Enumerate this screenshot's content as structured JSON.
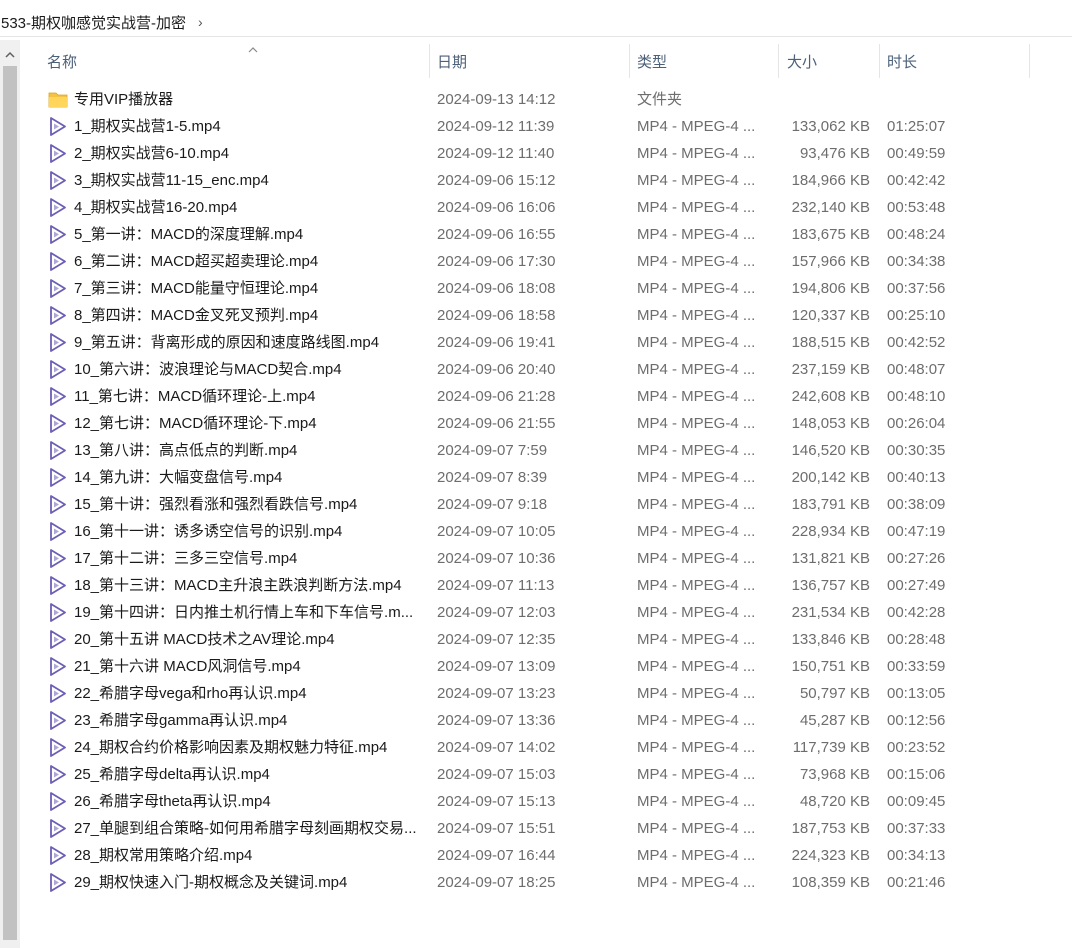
{
  "breadcrumb": {
    "path": "533-期权咖感觉实战营-加密"
  },
  "columns": {
    "name": "名称",
    "date": "日期",
    "type": "类型",
    "size": "大小",
    "duration": "时长"
  },
  "files": [
    {
      "name": "专用VIP播放器",
      "date": "2024-09-13 14:12",
      "type": "文件夹",
      "size": "",
      "duration": "",
      "icon": "folder-icon"
    },
    {
      "name": "1_期权实战营1-5.mp4",
      "date": "2024-09-12 11:39",
      "type": "MP4 - MPEG-4 ...",
      "size": "133,062 KB",
      "duration": "01:25:07",
      "icon": "video-file-icon"
    },
    {
      "name": "2_期权实战营6-10.mp4",
      "date": "2024-09-12 11:40",
      "type": "MP4 - MPEG-4 ...",
      "size": "93,476 KB",
      "duration": "00:49:59",
      "icon": "video-file-icon"
    },
    {
      "name": "3_期权实战营11-15_enc.mp4",
      "date": "2024-09-06 15:12",
      "type": "MP4 - MPEG-4 ...",
      "size": "184,966 KB",
      "duration": "00:42:42",
      "icon": "video-file-icon"
    },
    {
      "name": "4_期权实战营16-20.mp4",
      "date": "2024-09-06 16:06",
      "type": "MP4 - MPEG-4 ...",
      "size": "232,140 KB",
      "duration": "00:53:48",
      "icon": "video-file-icon"
    },
    {
      "name": "5_第一讲：MACD的深度理解.mp4",
      "date": "2024-09-06 16:55",
      "type": "MP4 - MPEG-4 ...",
      "size": "183,675 KB",
      "duration": "00:48:24",
      "icon": "video-file-icon"
    },
    {
      "name": "6_第二讲：MACD超买超卖理论.mp4",
      "date": "2024-09-06 17:30",
      "type": "MP4 - MPEG-4 ...",
      "size": "157,966 KB",
      "duration": "00:34:38",
      "icon": "video-file-icon"
    },
    {
      "name": "7_第三讲：MACD能量守恒理论.mp4",
      "date": "2024-09-06 18:08",
      "type": "MP4 - MPEG-4 ...",
      "size": "194,806 KB",
      "duration": "00:37:56",
      "icon": "video-file-icon"
    },
    {
      "name": "8_第四讲：MACD金叉死叉预判.mp4",
      "date": "2024-09-06 18:58",
      "type": "MP4 - MPEG-4 ...",
      "size": "120,337 KB",
      "duration": "00:25:10",
      "icon": "video-file-icon"
    },
    {
      "name": "9_第五讲：背离形成的原因和速度路线图.mp4",
      "date": "2024-09-06 19:41",
      "type": "MP4 - MPEG-4 ...",
      "size": "188,515 KB",
      "duration": "00:42:52",
      "icon": "video-file-icon"
    },
    {
      "name": "10_第六讲：波浪理论与MACD契合.mp4",
      "date": "2024-09-06 20:40",
      "type": "MP4 - MPEG-4 ...",
      "size": "237,159 KB",
      "duration": "00:48:07",
      "icon": "video-file-icon"
    },
    {
      "name": "11_第七讲：MACD循环理论-上.mp4",
      "date": "2024-09-06 21:28",
      "type": "MP4 - MPEG-4 ...",
      "size": "242,608 KB",
      "duration": "00:48:10",
      "icon": "video-file-icon"
    },
    {
      "name": "12_第七讲：MACD循环理论-下.mp4",
      "date": "2024-09-06 21:55",
      "type": "MP4 - MPEG-4 ...",
      "size": "148,053 KB",
      "duration": "00:26:04",
      "icon": "video-file-icon"
    },
    {
      "name": "13_第八讲：高点低点的判断.mp4",
      "date": "2024-09-07 7:59",
      "type": "MP4 - MPEG-4 ...",
      "size": "146,520 KB",
      "duration": "00:30:35",
      "icon": "video-file-icon"
    },
    {
      "name": "14_第九讲：大幅变盘信号.mp4",
      "date": "2024-09-07 8:39",
      "type": "MP4 - MPEG-4 ...",
      "size": "200,142 KB",
      "duration": "00:40:13",
      "icon": "video-file-icon"
    },
    {
      "name": "15_第十讲：强烈看涨和强烈看跌信号.mp4",
      "date": "2024-09-07 9:18",
      "type": "MP4 - MPEG-4 ...",
      "size": "183,791 KB",
      "duration": "00:38:09",
      "icon": "video-file-icon"
    },
    {
      "name": "16_第十一讲：诱多诱空信号的识别.mp4",
      "date": "2024-09-07 10:05",
      "type": "MP4 - MPEG-4 ...",
      "size": "228,934 KB",
      "duration": "00:47:19",
      "icon": "video-file-icon"
    },
    {
      "name": "17_第十二讲：三多三空信号.mp4",
      "date": "2024-09-07 10:36",
      "type": "MP4 - MPEG-4 ...",
      "size": "131,821 KB",
      "duration": "00:27:26",
      "icon": "video-file-icon"
    },
    {
      "name": "18_第十三讲：MACD主升浪主跌浪判断方法.mp4",
      "date": "2024-09-07 11:13",
      "type": "MP4 - MPEG-4 ...",
      "size": "136,757 KB",
      "duration": "00:27:49",
      "icon": "video-file-icon"
    },
    {
      "name": "19_第十四讲：日内推土机行情上车和下车信号.m...",
      "date": "2024-09-07 12:03",
      "type": "MP4 - MPEG-4 ...",
      "size": "231,534 KB",
      "duration": "00:42:28",
      "icon": "video-file-icon"
    },
    {
      "name": "20_第十五讲 MACD技术之AV理论.mp4",
      "date": "2024-09-07 12:35",
      "type": "MP4 - MPEG-4 ...",
      "size": "133,846 KB",
      "duration": "00:28:48",
      "icon": "video-file-icon"
    },
    {
      "name": "21_第十六讲 MACD风洞信号.mp4",
      "date": "2024-09-07 13:09",
      "type": "MP4 - MPEG-4 ...",
      "size": "150,751 KB",
      "duration": "00:33:59",
      "icon": "video-file-icon"
    },
    {
      "name": "22_希腊字母vega和rho再认识.mp4",
      "date": "2024-09-07 13:23",
      "type": "MP4 - MPEG-4 ...",
      "size": "50,797 KB",
      "duration": "00:13:05",
      "icon": "video-file-icon"
    },
    {
      "name": "23_希腊字母gamma再认识.mp4",
      "date": "2024-09-07 13:36",
      "type": "MP4 - MPEG-4 ...",
      "size": "45,287 KB",
      "duration": "00:12:56",
      "icon": "video-file-icon"
    },
    {
      "name": "24_期权合约价格影响因素及期权魅力特征.mp4",
      "date": "2024-09-07 14:02",
      "type": "MP4 - MPEG-4 ...",
      "size": "117,739 KB",
      "duration": "00:23:52",
      "icon": "video-file-icon"
    },
    {
      "name": "25_希腊字母delta再认识.mp4",
      "date": "2024-09-07 15:03",
      "type": "MP4 - MPEG-4 ...",
      "size": "73,968 KB",
      "duration": "00:15:06",
      "icon": "video-file-icon"
    },
    {
      "name": "26_希腊字母theta再认识.mp4",
      "date": "2024-09-07 15:13",
      "type": "MP4 - MPEG-4 ...",
      "size": "48,720 KB",
      "duration": "00:09:45",
      "icon": "video-file-icon"
    },
    {
      "name": "27_单腿到组合策略-如何用希腊字母刻画期权交易...",
      "date": "2024-09-07 15:51",
      "type": "MP4 - MPEG-4 ...",
      "size": "187,753 KB",
      "duration": "00:37:33",
      "icon": "video-file-icon"
    },
    {
      "name": "28_期权常用策略介绍.mp4",
      "date": "2024-09-07 16:44",
      "type": "MP4 - MPEG-4 ...",
      "size": "224,323 KB",
      "duration": "00:34:13",
      "icon": "video-file-icon"
    },
    {
      "name": "29_期权快速入门-期权概念及关键词.mp4",
      "date": "2024-09-07 18:25",
      "type": "MP4 - MPEG-4 ...",
      "size": "108,359 KB",
      "duration": "00:21:46",
      "icon": "video-file-icon"
    }
  ],
  "colors": {
    "header_text": "#4c607a",
    "muted_text": "#6d6d6d",
    "video_icon": "#6b5fb5",
    "folder_icon": "#f5c242"
  }
}
